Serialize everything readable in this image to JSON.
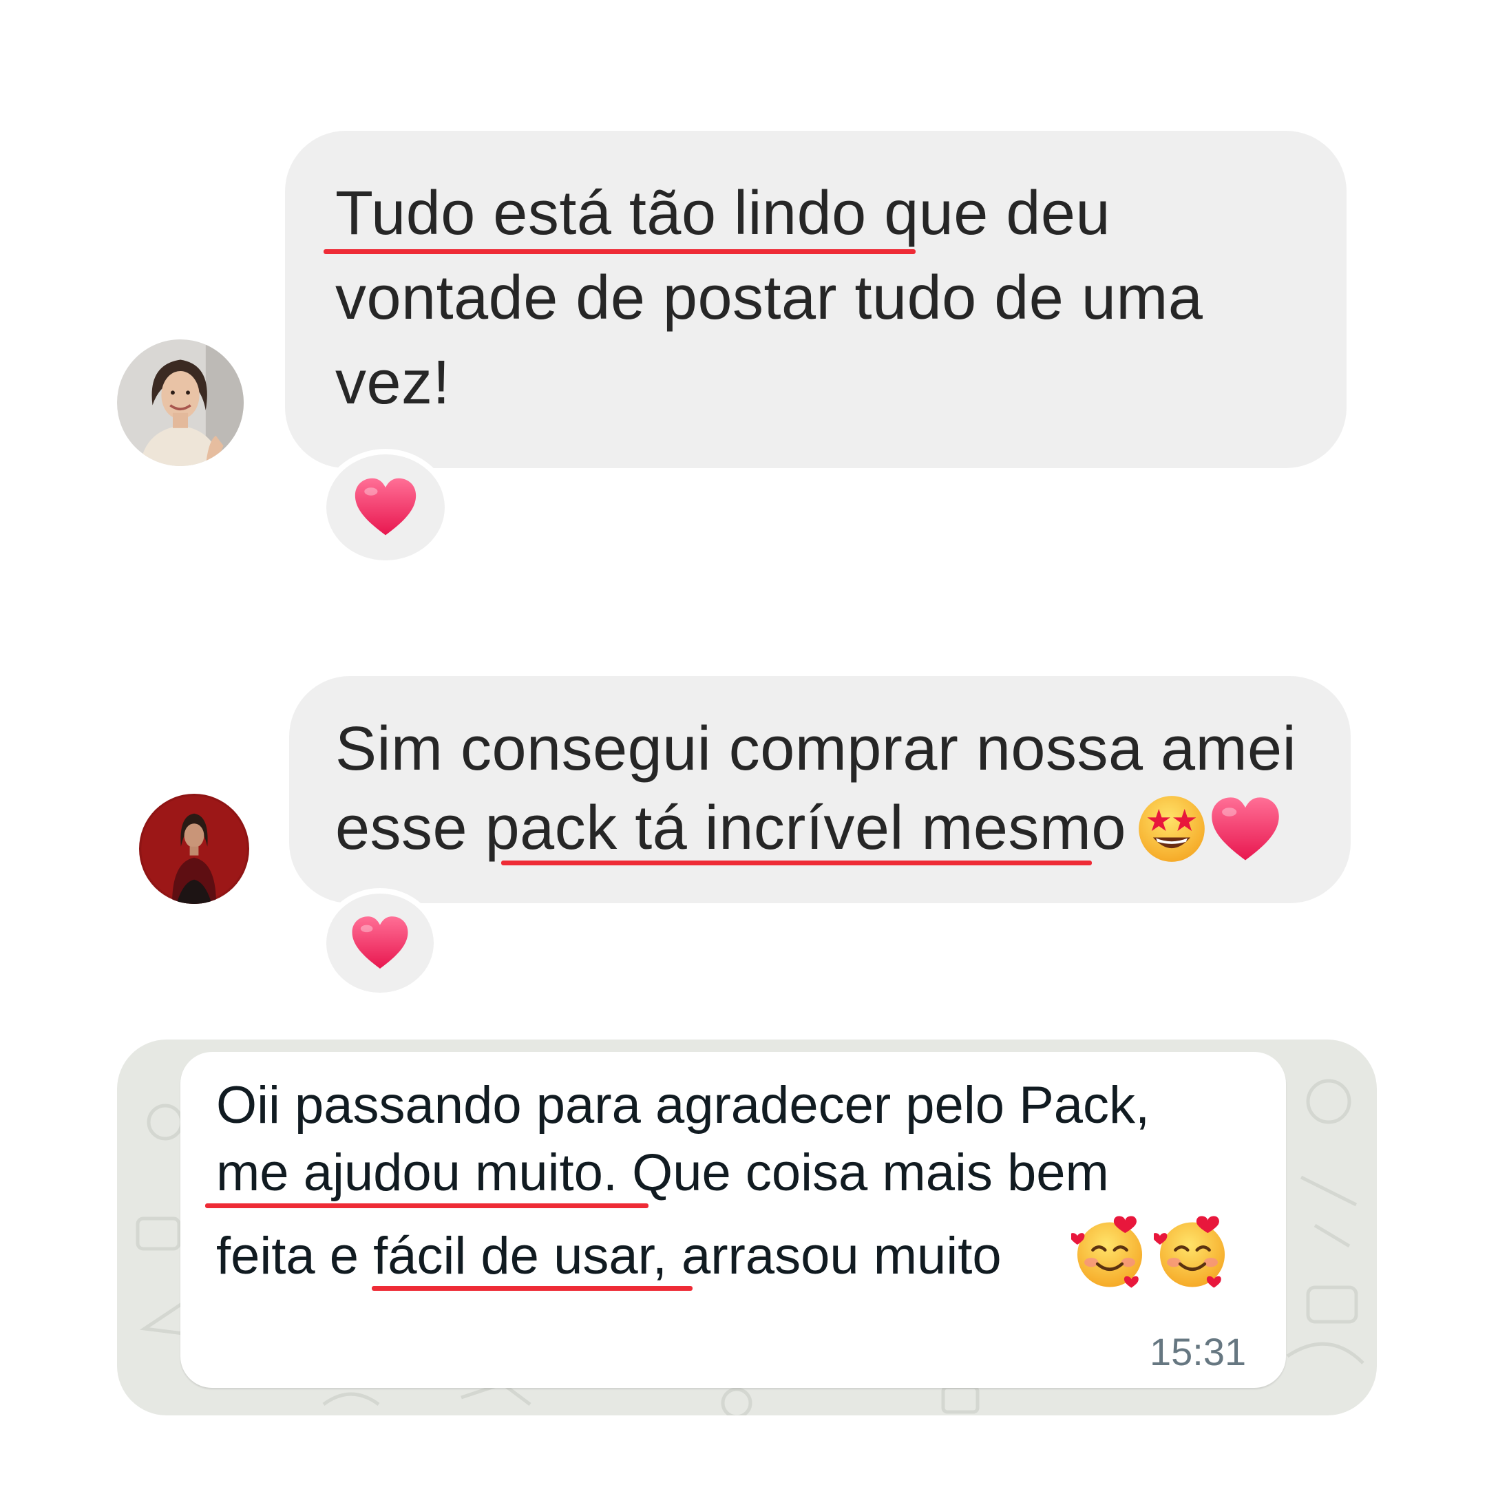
{
  "conversation_1": {
    "message": {
      "lines": [
        "Tudo está tão lindo que deu",
        "vontade de postar tudo de uma",
        "vez!"
      ],
      "highlighted": "Tudo está tão lindo"
    },
    "reaction": "heart-icon"
  },
  "conversation_2": {
    "message": {
      "lines": [
        "Sim consegui comprar nossa amei",
        "esse pack tá incrível mesmo"
      ],
      "highlighted": "pack tá incrível mesmo",
      "emojis": [
        "star-struck-emoji",
        "heart-emoji"
      ]
    },
    "reaction": "heart-icon"
  },
  "whatsapp_message": {
    "lines": [
      "Oii passando para agradecer pelo Pack,",
      "me ajudou muito. Que coisa mais bem",
      "feita e fácil de usar, arrasou muito"
    ],
    "highlighted": [
      "me ajudou muito",
      "fácil de usar"
    ],
    "emojis": [
      "smiling-face-with-hearts-emoji",
      "smiling-face-with-hearts-emoji"
    ],
    "time": "15:31"
  },
  "colors": {
    "instagram_bubble": "#efefef",
    "whatsapp_background": "#e6e8e3",
    "whatsapp_bubble": "#ffffff",
    "highlight_underline": "#ee2b36",
    "heart": "#f53c6a"
  }
}
